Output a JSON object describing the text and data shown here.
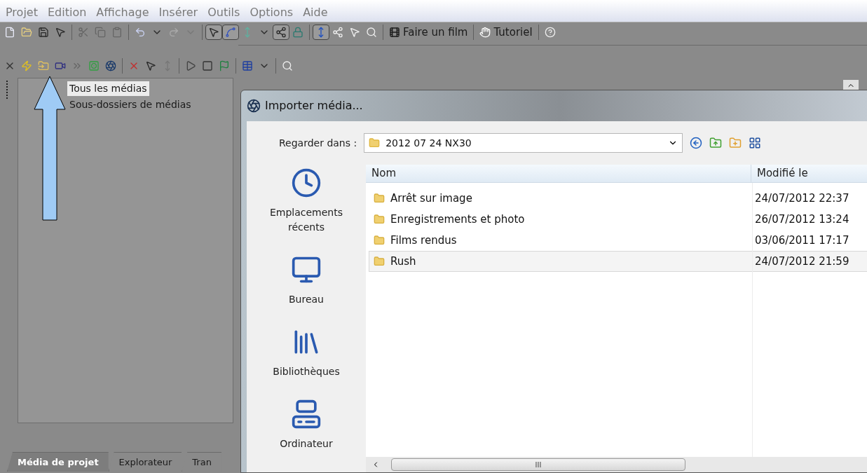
{
  "menu": [
    "Projet",
    "Edition",
    "Affichage",
    "Insérer",
    "Outils",
    "Options",
    "Aide"
  ],
  "toolbar": {
    "make_movie": "Faire un film",
    "tutorial": "Tutoriel"
  },
  "media_tree": [
    {
      "label": "Tous les médias",
      "selected": true
    },
    {
      "label": "Sous-dossiers de médias",
      "selected": false
    }
  ],
  "bottom_tabs": [
    {
      "label": "Média de projet",
      "selected": true
    },
    {
      "label": "Explorateur",
      "selected": false
    },
    {
      "label": "Tran",
      "selected": false
    }
  ],
  "dialog": {
    "title": "Importer média...",
    "look_in_label": "Regarder dans :",
    "look_in_value": "2012 07 24 NX30",
    "places": [
      {
        "kind": "recent",
        "label": "Emplacements récents"
      },
      {
        "kind": "desktop",
        "label": "Bureau"
      },
      {
        "kind": "libraries",
        "label": "Bibliothèques"
      },
      {
        "kind": "computer",
        "label": "Ordinateur"
      }
    ],
    "columns": [
      "Nom",
      "Modifié le"
    ],
    "files": [
      {
        "name": "Arrêt sur image",
        "modified": "24/07/2012 22:37",
        "selected": false
      },
      {
        "name": "Enregistrements et photo",
        "modified": "26/07/2012 13:24",
        "selected": false
      },
      {
        "name": "Films rendus",
        "modified": "03/06/2011 17:17",
        "selected": false
      },
      {
        "name": "Rush",
        "modified": "24/07/2012 21:59",
        "selected": true
      }
    ],
    "scroll_thumb": "III"
  }
}
